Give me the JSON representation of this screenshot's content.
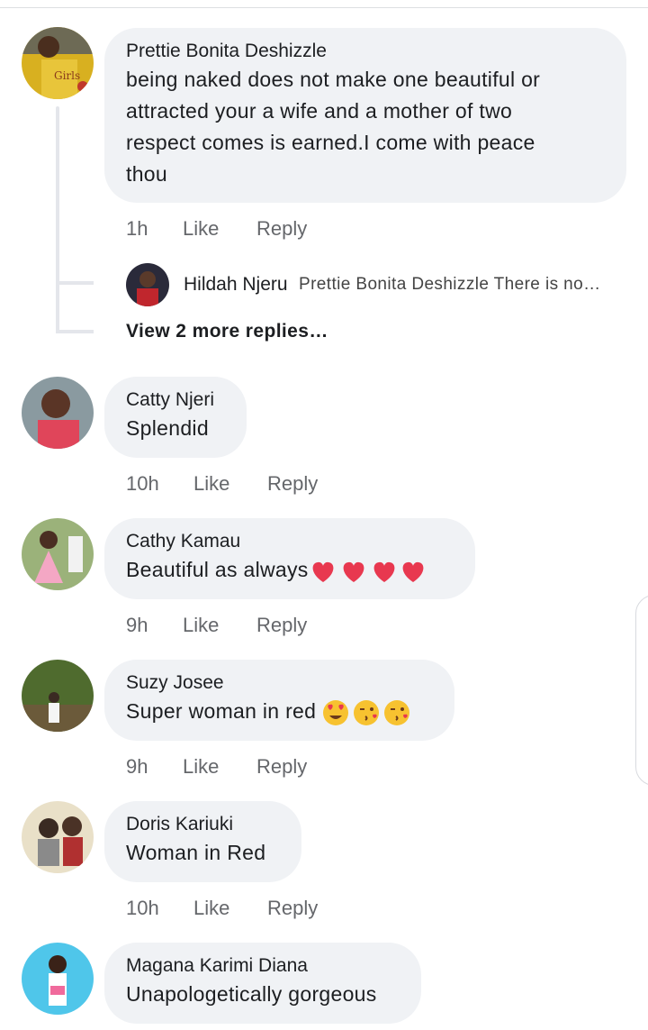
{
  "comments": [
    {
      "author": "Prettie Bonita Deshizzle",
      "text_lines": [
        "being naked does not make one beautiful or",
        "attracted your a wife and a mother of two",
        "respect comes is earned.I come with peace",
        "thou"
      ],
      "time": "1h",
      "like_label": "Like",
      "reply_label": "Reply",
      "avatar_text": "Girls"
    },
    {
      "author": "Catty Njeri",
      "text": "Splendid",
      "time": "10h",
      "like_label": "Like",
      "reply_label": "Reply"
    },
    {
      "author": "Cathy Kamau",
      "text": "Beautiful as always",
      "emojis": [
        "heart-icon",
        "heart-icon",
        "heart-icon",
        "heart-icon"
      ],
      "time": "9h",
      "like_label": "Like",
      "reply_label": "Reply"
    },
    {
      "author": "Suzy Josee",
      "text": "Super woman in red ",
      "emojis": [
        "heart-eyes-icon",
        "kiss-icon",
        "kiss-icon"
      ],
      "time": "9h",
      "like_label": "Like",
      "reply_label": "Reply"
    },
    {
      "author": "Doris Kariuki",
      "text": "Woman in Red",
      "time": "10h",
      "like_label": "Like",
      "reply_label": "Reply"
    },
    {
      "author": "Magana Karimi Diana",
      "text": "Unapologetically gorgeous"
    }
  ],
  "reply_preview": {
    "author": "Hildah Njeru",
    "snippet": "Prettie Bonita Deshizzle There is no…"
  },
  "view_more": "View 2 more replies…",
  "colors": {
    "bubble": "#f0f2f5",
    "meta": "#65676b",
    "thread": "#e4e6eb"
  }
}
